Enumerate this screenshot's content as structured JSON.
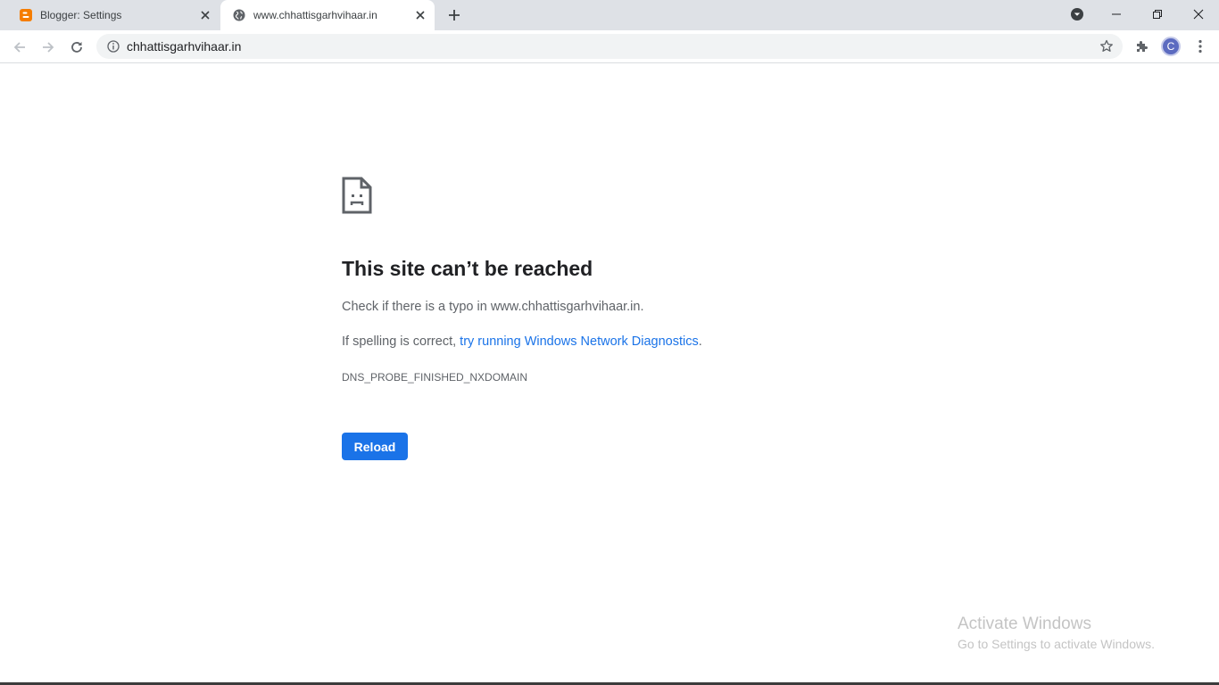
{
  "tabs": [
    {
      "title": "Blogger: Settings",
      "icon": "blogger-icon",
      "active": false
    },
    {
      "title": "www.chhattisgarhvihaar.in",
      "icon": "globe-icon",
      "active": true
    }
  ],
  "toolbar": {
    "url": "chhattisgarhvihaar.in",
    "profile_initial": "C"
  },
  "error": {
    "title": "This site can’t be reached",
    "line1": "Check if there is a typo in www.chhattisgarhvihaar.in.",
    "line2_prefix": "If spelling is correct, ",
    "line2_link": "try running Windows Network Diagnostics",
    "line2_suffix": ".",
    "code": "DNS_PROBE_FINISHED_NXDOMAIN",
    "reload_label": "Reload"
  },
  "watermark": {
    "title": "Activate Windows",
    "subtitle": "Go to Settings to activate Windows."
  },
  "colors": {
    "accent": "#1a73e8",
    "blogger": "#f57d00",
    "tabstrip": "#dee1e6",
    "avatar": "#5c6bc0"
  }
}
